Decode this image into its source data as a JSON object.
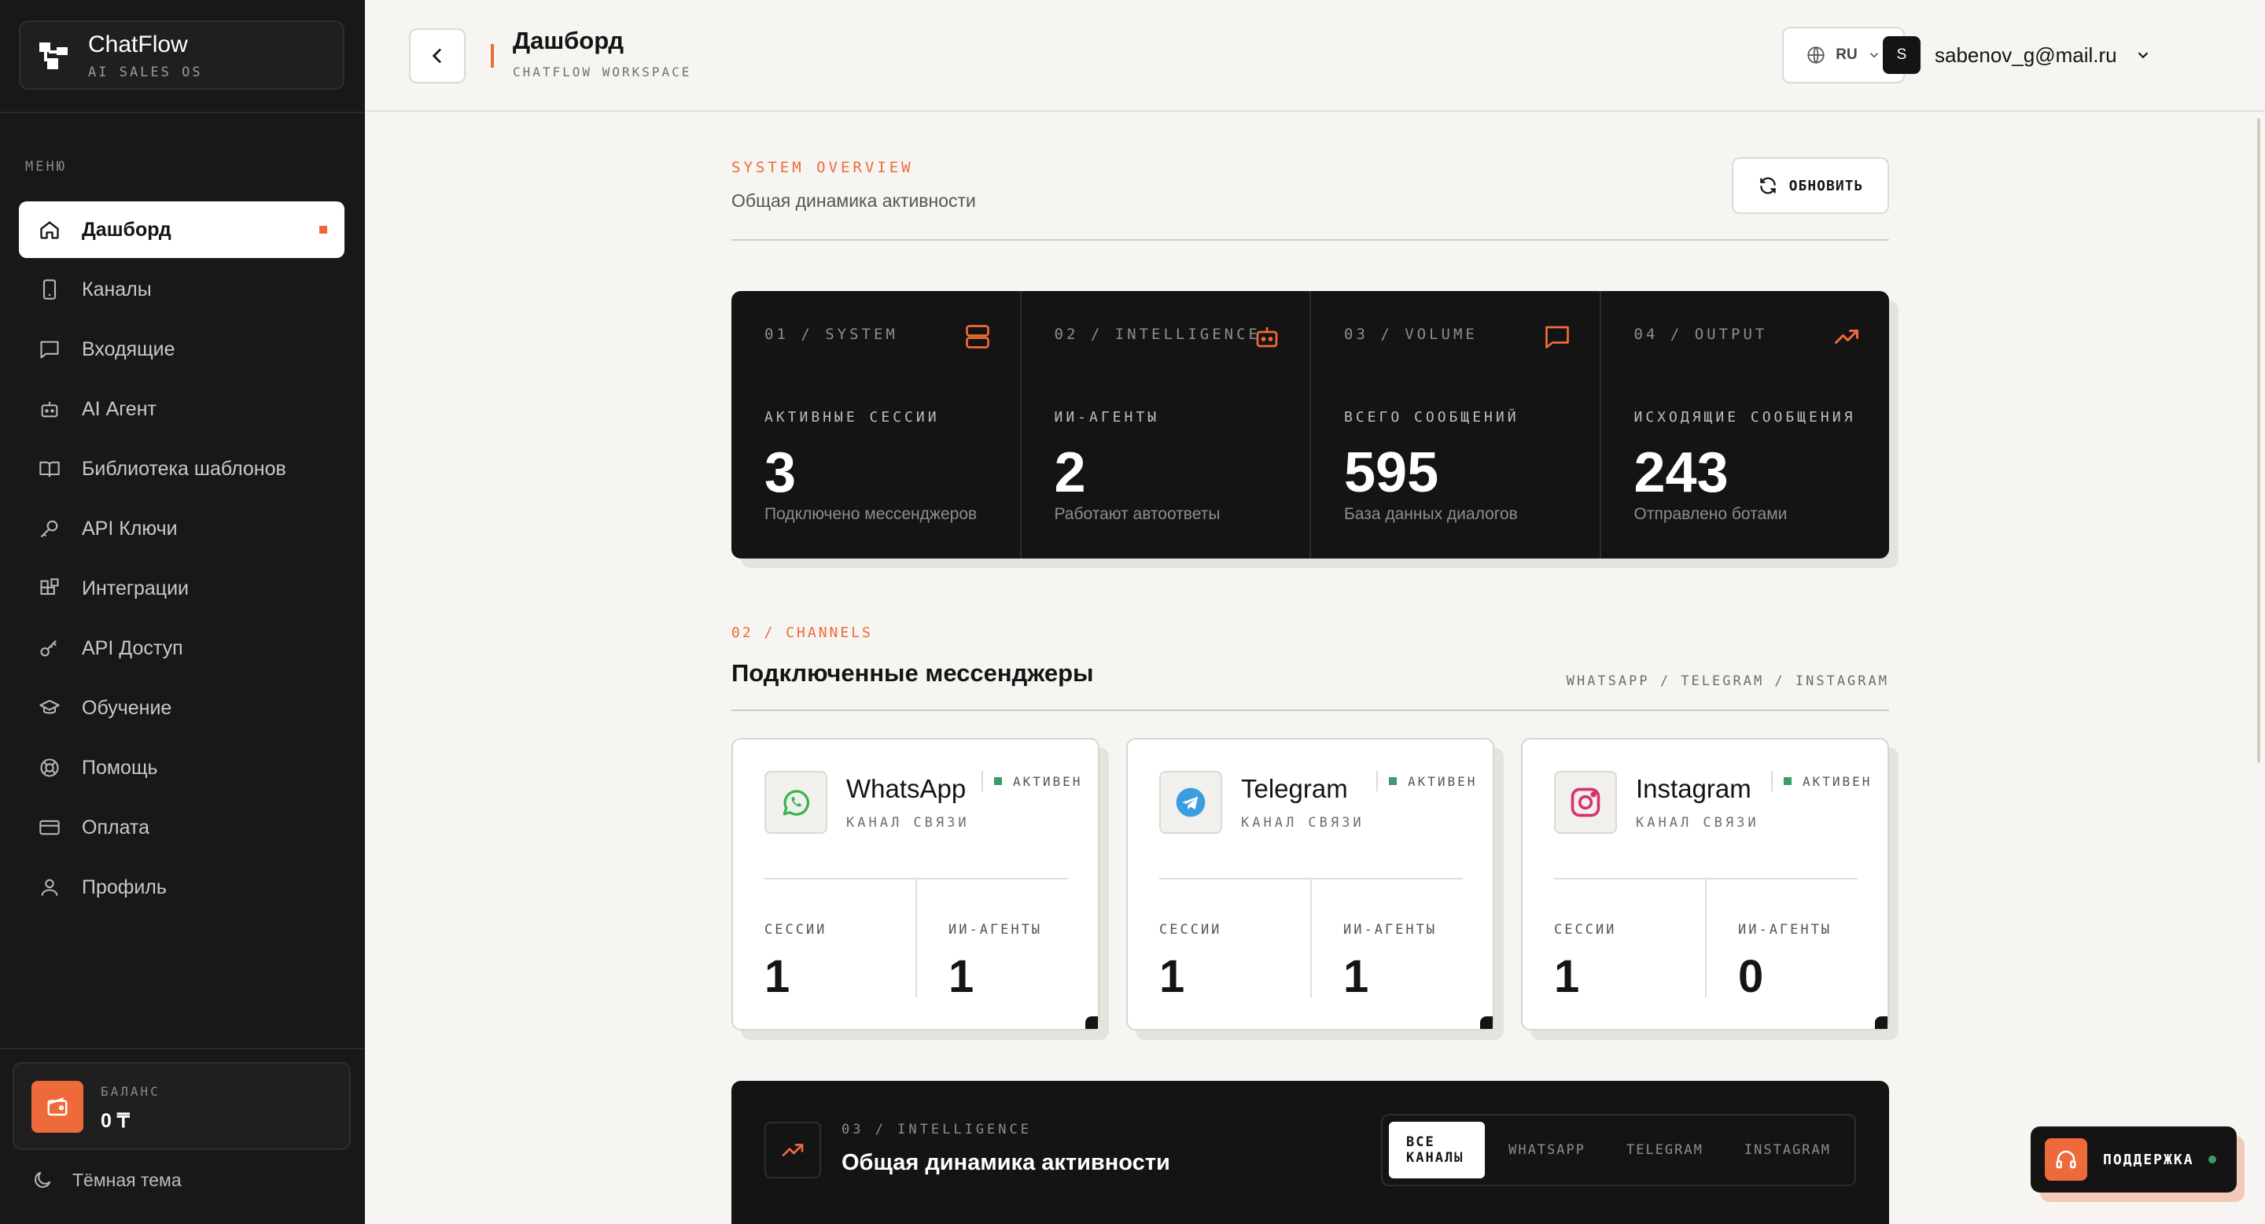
{
  "app": {
    "name": "ChatFlow",
    "tagline": "AI SALES OS"
  },
  "sidebar": {
    "menu_heading": "МЕНЮ",
    "items": [
      {
        "label": "Дашборд",
        "icon": "home-icon",
        "active": true
      },
      {
        "label": "Каналы",
        "icon": "phone-icon"
      },
      {
        "label": "Входящие",
        "icon": "message-icon"
      },
      {
        "label": "AI Агент",
        "icon": "bot-icon"
      },
      {
        "label": "Библиотека шаблонов",
        "icon": "book-icon"
      },
      {
        "label": "API Ключи",
        "icon": "key-icon"
      },
      {
        "label": "Интеграции",
        "icon": "grid-icon"
      },
      {
        "label": "API Доступ",
        "icon": "key-alt-icon"
      },
      {
        "label": "Обучение",
        "icon": "graduation-cap-icon"
      },
      {
        "label": "Помощь",
        "icon": "lifebuoy-icon"
      },
      {
        "label": "Оплата",
        "icon": "credit-card-icon"
      },
      {
        "label": "Профиль",
        "icon": "user-icon"
      }
    ],
    "balance": {
      "label": "БАЛАНС",
      "value": "0 ₸"
    },
    "theme_toggle": "Тёмная тема"
  },
  "header": {
    "title": "Дашборд",
    "subtitle": "CHATFLOW WORKSPACE",
    "language": "RU",
    "user_initial": "S",
    "user_email": "sabenov_g@mail.ru"
  },
  "overview": {
    "kicker": "SYSTEM OVERVIEW",
    "subtitle": "Общая динамика активности",
    "refresh_label": "ОБНОВИТЬ"
  },
  "stats": [
    {
      "kicker": "01 / SYSTEM",
      "icon": "server-icon",
      "label": "АКТИВНЫЕ СЕССИИ",
      "value": "3",
      "desc": "Подключено мессенджеров"
    },
    {
      "kicker": "02 / INTELLIGENCE",
      "icon": "bot-icon",
      "label": "ИИ-АГЕНТЫ",
      "value": "2",
      "desc": "Работают автоответы"
    },
    {
      "kicker": "03 / VOLUME",
      "icon": "message-icon",
      "label": "ВСЕГО СООБЩЕНИЙ",
      "value": "595",
      "desc": "База данных диалогов"
    },
    {
      "kicker": "04 / OUTPUT",
      "icon": "trending-up-icon",
      "label": "ИСХОДЯЩИЕ СООБЩЕНИЯ",
      "value": "243",
      "desc": "Отправлено ботами"
    }
  ],
  "channels": {
    "kicker": "02 / CHANNELS",
    "title": "Подключенные мессенджеры",
    "tags": "WHATSAPP / TELEGRAM / INSTAGRAM",
    "cards": [
      {
        "name": "WhatsApp",
        "type": "КАНАЛ СВЯЗИ",
        "status": "АКТИВЕН",
        "sessions_label": "СЕССИИ",
        "sessions": "1",
        "agents_label": "ИИ-АГЕНТЫ",
        "agents": "1",
        "color": "#3ab44a"
      },
      {
        "name": "Telegram",
        "type": "КАНАЛ СВЯЗИ",
        "status": "АКТИВЕН",
        "sessions_label": "СЕССИИ",
        "sessions": "1",
        "agents_label": "ИИ-АГЕНТЫ",
        "agents": "1",
        "color": "#3b9ee0"
      },
      {
        "name": "Instagram",
        "type": "КАНАЛ СВЯЗИ",
        "status": "АКТИВЕН",
        "sessions_label": "СЕССИИ",
        "sessions": "1",
        "agents_label": "ИИ-АГЕНТЫ",
        "agents": "0",
        "color": "#d6336c"
      }
    ]
  },
  "intelligence": {
    "kicker": "03 / INTELLIGENCE",
    "title": "Общая динамика активности",
    "tabs": [
      "ВСЕ КАНАЛЫ",
      "WHATSAPP",
      "TELEGRAM",
      "INSTAGRAM"
    ]
  },
  "support": {
    "label": "ПОДДЕРЖКА"
  },
  "colors": {
    "accent": "#ef6a3a",
    "status_ok": "#3d9a6a",
    "dark": "#141414"
  }
}
